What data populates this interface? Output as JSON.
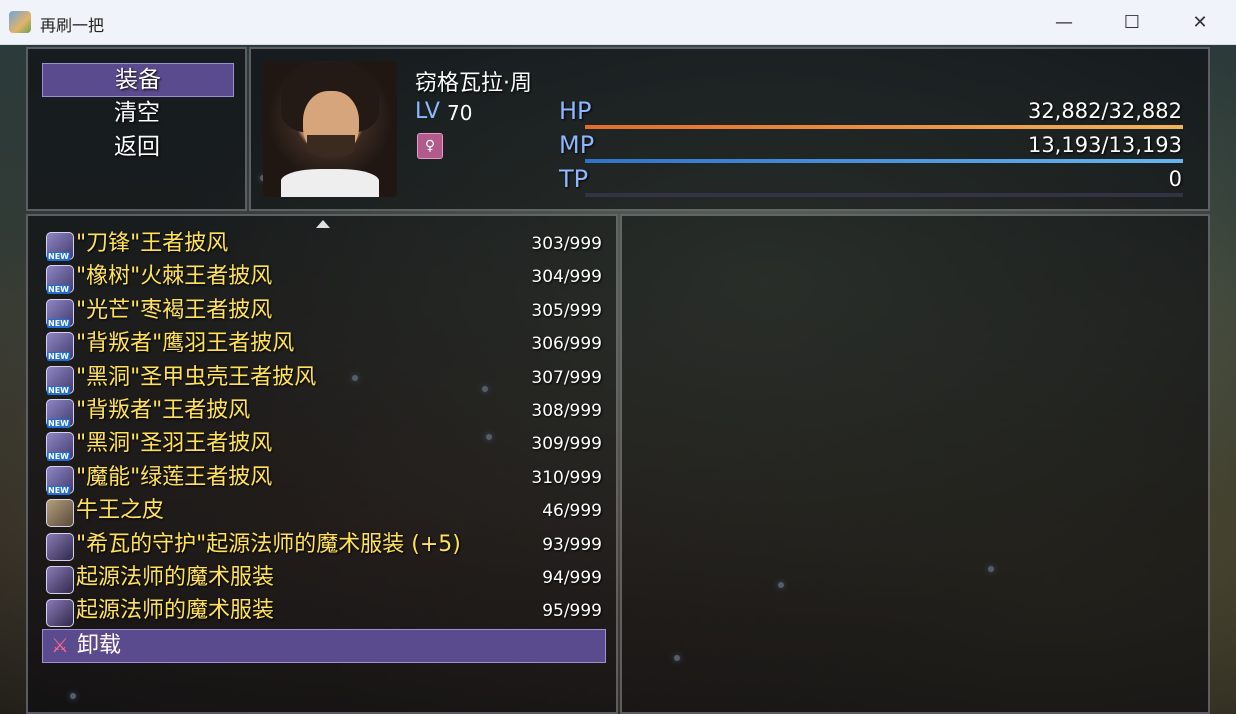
{
  "window": {
    "title": "再刷一把",
    "controls": {
      "minimize": "—",
      "maximize": "☐",
      "close": "✕"
    }
  },
  "command_menu": {
    "items": [
      {
        "label": "装备",
        "selected": true
      },
      {
        "label": "清空",
        "selected": false
      },
      {
        "label": "返回",
        "selected": false
      }
    ]
  },
  "actor": {
    "name": "窃格瓦拉·周",
    "level_label": "LV",
    "level_value": "70",
    "class_icon": "female-symbol-icon",
    "gauges": [
      {
        "label": "HP",
        "value": "32,882/32,882",
        "fill": 1.0,
        "colors": [
          "#e26d2b",
          "#f2b35b"
        ]
      },
      {
        "label": "MP",
        "value": "13,193/13,193",
        "fill": 1.0,
        "colors": [
          "#2e73c8",
          "#65b7f1"
        ]
      },
      {
        "label": "TP",
        "value": "0",
        "fill": 0.0,
        "colors": [
          "#3b9b3b",
          "#9be05b"
        ]
      }
    ]
  },
  "item_list": {
    "items": [
      {
        "name": "\"刀锋\"王者披风",
        "count": "303/999",
        "icon": "cloak-icon",
        "is_new": true,
        "new_label": "NEW"
      },
      {
        "name": "\"橡树\"火棘王者披风",
        "count": "304/999",
        "icon": "cloak-icon",
        "is_new": true,
        "new_label": "NEW"
      },
      {
        "name": "\"光芒\"枣褐王者披风",
        "count": "305/999",
        "icon": "cloak-icon",
        "is_new": true,
        "new_label": "NEW"
      },
      {
        "name": "\"背叛者\"鹰羽王者披风",
        "count": "306/999",
        "icon": "cloak-icon",
        "is_new": true,
        "new_label": "NEW"
      },
      {
        "name": "\"黑洞\"圣甲虫壳王者披风",
        "count": "307/999",
        "icon": "cloak-icon",
        "is_new": true,
        "new_label": "NEW"
      },
      {
        "name": "\"背叛者\"王者披风",
        "count": "308/999",
        "icon": "cloak-icon",
        "is_new": true,
        "new_label": "NEW"
      },
      {
        "name": "\"黑洞\"圣羽王者披风",
        "count": "309/999",
        "icon": "cloak-icon",
        "is_new": true,
        "new_label": "NEW"
      },
      {
        "name": "\"魔能\"绿莲王者披风",
        "count": "310/999",
        "icon": "cloak-icon",
        "is_new": true,
        "new_label": "NEW"
      },
      {
        "name": "牛王之皮",
        "count": "46/999",
        "icon": "beast-hide-icon",
        "is_new": false,
        "new_label": ""
      },
      {
        "name": "\"希瓦的守护\"起源法师的魔术服装 (+5)",
        "count": "93/999",
        "icon": "robe-icon",
        "is_new": false,
        "new_label": ""
      },
      {
        "name": "起源法师的魔术服装",
        "count": "94/999",
        "icon": "robe-icon",
        "is_new": false,
        "new_label": ""
      },
      {
        "name": "起源法师的魔术服装",
        "count": "95/999",
        "icon": "robe-icon",
        "is_new": false,
        "new_label": ""
      }
    ],
    "unequip": {
      "label": "卸载",
      "icon": "unequip-icon"
    }
  }
}
